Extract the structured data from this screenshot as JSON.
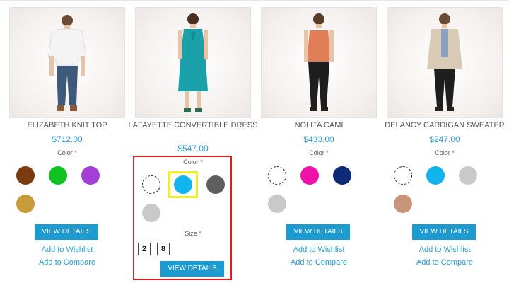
{
  "products": [
    {
      "name": "ELIZABETH KNIT TOP",
      "price": "$712.00",
      "color_label": "Color",
      "required_mark": "*",
      "swatches": [
        "#7a3b10",
        "#10c21f",
        "#a33fd6",
        "#c79a3a"
      ],
      "view_details": "VIEW DETAILS",
      "wishlist": "Add to Wishlist",
      "compare": "Add to Compare"
    },
    {
      "name": "LAFAYETTE CONVERTIBLE DRESS",
      "price": "$547.00",
      "color_label": "Color",
      "required_mark": "*",
      "swatches": [
        "#ffffff",
        "#12b4ee",
        "#5e5e5e",
        "#c9c9c9"
      ],
      "selected_swatch": "#12b4ee",
      "size_label": "Size",
      "sizes": [
        "2",
        "8"
      ],
      "view_details": "VIEW DETAILS"
    },
    {
      "name": "NOLITA CAMI",
      "price": "$433.00",
      "color_label": "Color",
      "required_mark": "*",
      "swatches": [
        "#ffffff",
        "#ee12a8",
        "#0e2a78",
        "#c9c9c9"
      ],
      "view_details": "VIEW DETAILS",
      "wishlist": "Add to Wishlist",
      "compare": "Add to Compare"
    },
    {
      "name": "DELANCY CARDIGAN SWEATER",
      "price": "$247.00",
      "color_label": "Color",
      "required_mark": "*",
      "swatches": [
        "#ffffff",
        "#12b4ee",
        "#c9c9c9",
        "#c9957a"
      ],
      "view_details": "VIEW DETAILS",
      "wishlist": "Add to Wishlist",
      "compare": "Add to Compare"
    }
  ],
  "colors": {
    "accent": "#1a9bd2",
    "price": "#2f9bd3",
    "highlight_border": "#e01b1b",
    "selected_frame": "#f0ef20"
  }
}
